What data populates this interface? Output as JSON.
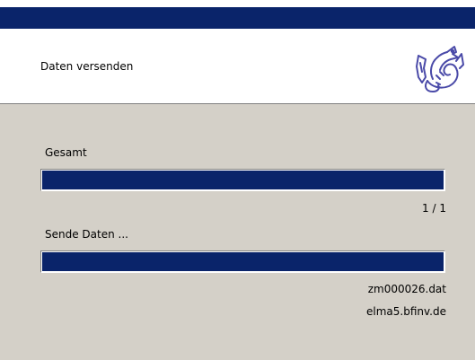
{
  "header": {
    "title": "Daten versenden",
    "logo_icon": "dragon-logo-icon"
  },
  "progress_total": {
    "label": "Gesamt",
    "value": 1.0,
    "count_text": "1 / 1"
  },
  "progress_send": {
    "label": "Sende Daten ...",
    "value": 1.0,
    "file_name": "zm000026.dat",
    "host": "elma5.bfinv.de"
  },
  "colors": {
    "title_bar": "#0a246a",
    "progress_fill": "#0a246a",
    "body_background": "#d4d0c8",
    "header_background": "#ffffff",
    "logo_stroke": "#4a4aa8"
  }
}
